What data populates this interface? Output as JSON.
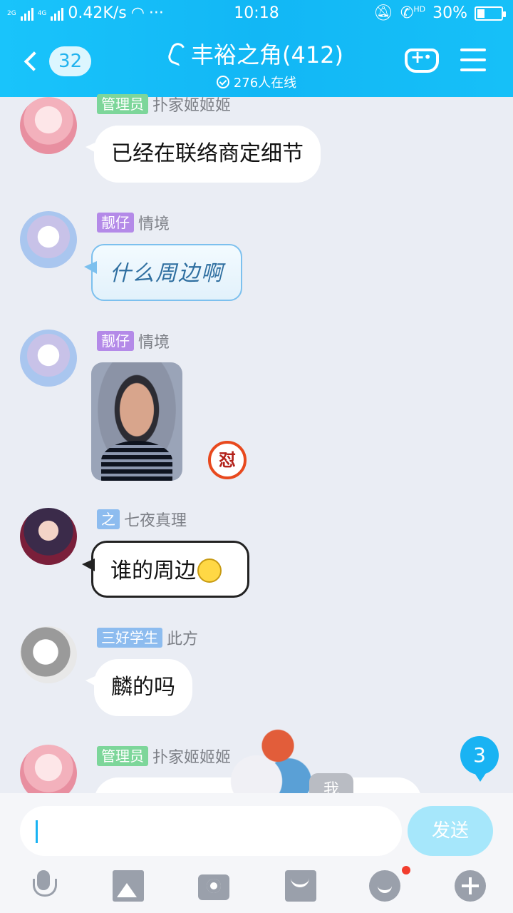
{
  "status_bar": {
    "network_labels": [
      "2G",
      "4G"
    ],
    "speed": "0.42K/s",
    "more": "···",
    "time": "10:18",
    "hd": "HD",
    "battery_text": "30%",
    "battery_level": 0.3
  },
  "header": {
    "unread_count": "32",
    "group_title": "丰裕之角(412)",
    "online_text": "276人在线",
    "icons": [
      "back-chevron-icon",
      "ear-icon",
      "gamepad-icon",
      "menu-icon"
    ]
  },
  "messages": [
    {
      "avatar": "pink-hair-avatar",
      "tag": "管理员",
      "nick": "扑家姬姬姬",
      "text": "已经在联络商定细节"
    },
    {
      "avatar": "blue-dress-avatar",
      "tag": "靓仔",
      "nick": "情境",
      "text": "什么周边啊"
    },
    {
      "avatar": "blue-dress-avatar",
      "tag": "靓仔",
      "nick": "情境",
      "badge": "怼"
    },
    {
      "avatar": "dark-boy-avatar",
      "tag": "之",
      "nick": "七夜真理",
      "text": "谁的周边"
    },
    {
      "avatar": "gray-sketch-avatar",
      "tag": "三好学生",
      "nick": "此方",
      "text": "麟的吗"
    },
    {
      "avatar": "pink-hair-avatar",
      "tag": "管理员",
      "nick": "扑家姬姬姬"
    }
  ],
  "new_message_badge": "3",
  "self_label": "我",
  "composer": {
    "input_value": "",
    "send_label": "发送"
  },
  "toolbar_icons": [
    "microphone-icon",
    "image-icon",
    "camera-icon",
    "red-packet-icon",
    "emoji-icon",
    "plus-icon"
  ],
  "colors": {
    "header": "#12b7f5",
    "background": "#eaedf4",
    "admin_tag": "#7dd69a",
    "vip_tag": "#b48ae8",
    "title_tag": "#8dbcef",
    "send_button": "#a6e7fb",
    "notification_dot": "#f23d2e"
  }
}
